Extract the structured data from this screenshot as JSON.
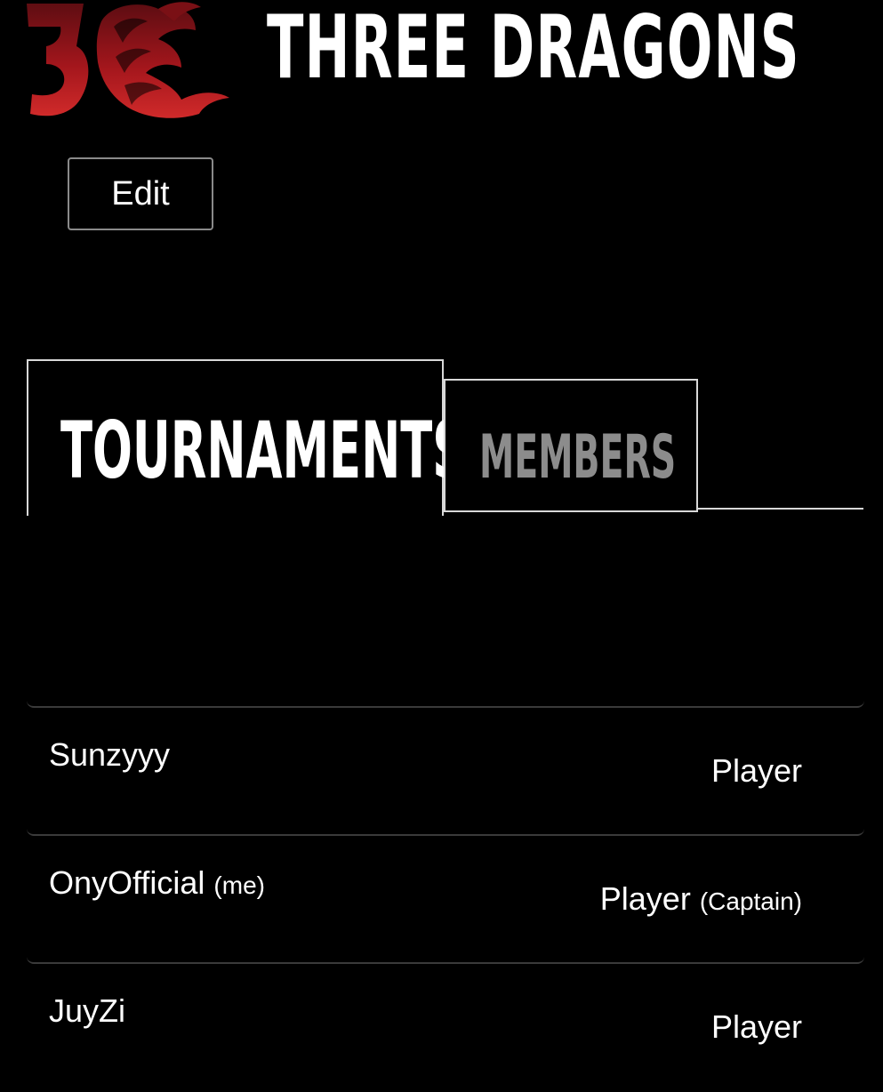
{
  "team": {
    "name": "THREE DRAGONS",
    "logo_icon": "three-dragons-logo",
    "brand_color": "#b3171d"
  },
  "actions": {
    "edit_label": "Edit"
  },
  "tabs": [
    {
      "label": "TOURNAMENTS",
      "selected": true
    },
    {
      "label": "MEMBERS",
      "selected": false
    }
  ],
  "members": [
    {
      "name": "Sunzyyy",
      "name_note": "",
      "role": "Player",
      "role_note": ""
    },
    {
      "name": "OnyOfficial",
      "name_note": "(me)",
      "role": "Player",
      "role_note": "(Captain)"
    },
    {
      "name": "JuyZi",
      "name_note": "",
      "role": "Player",
      "role_note": ""
    }
  ]
}
